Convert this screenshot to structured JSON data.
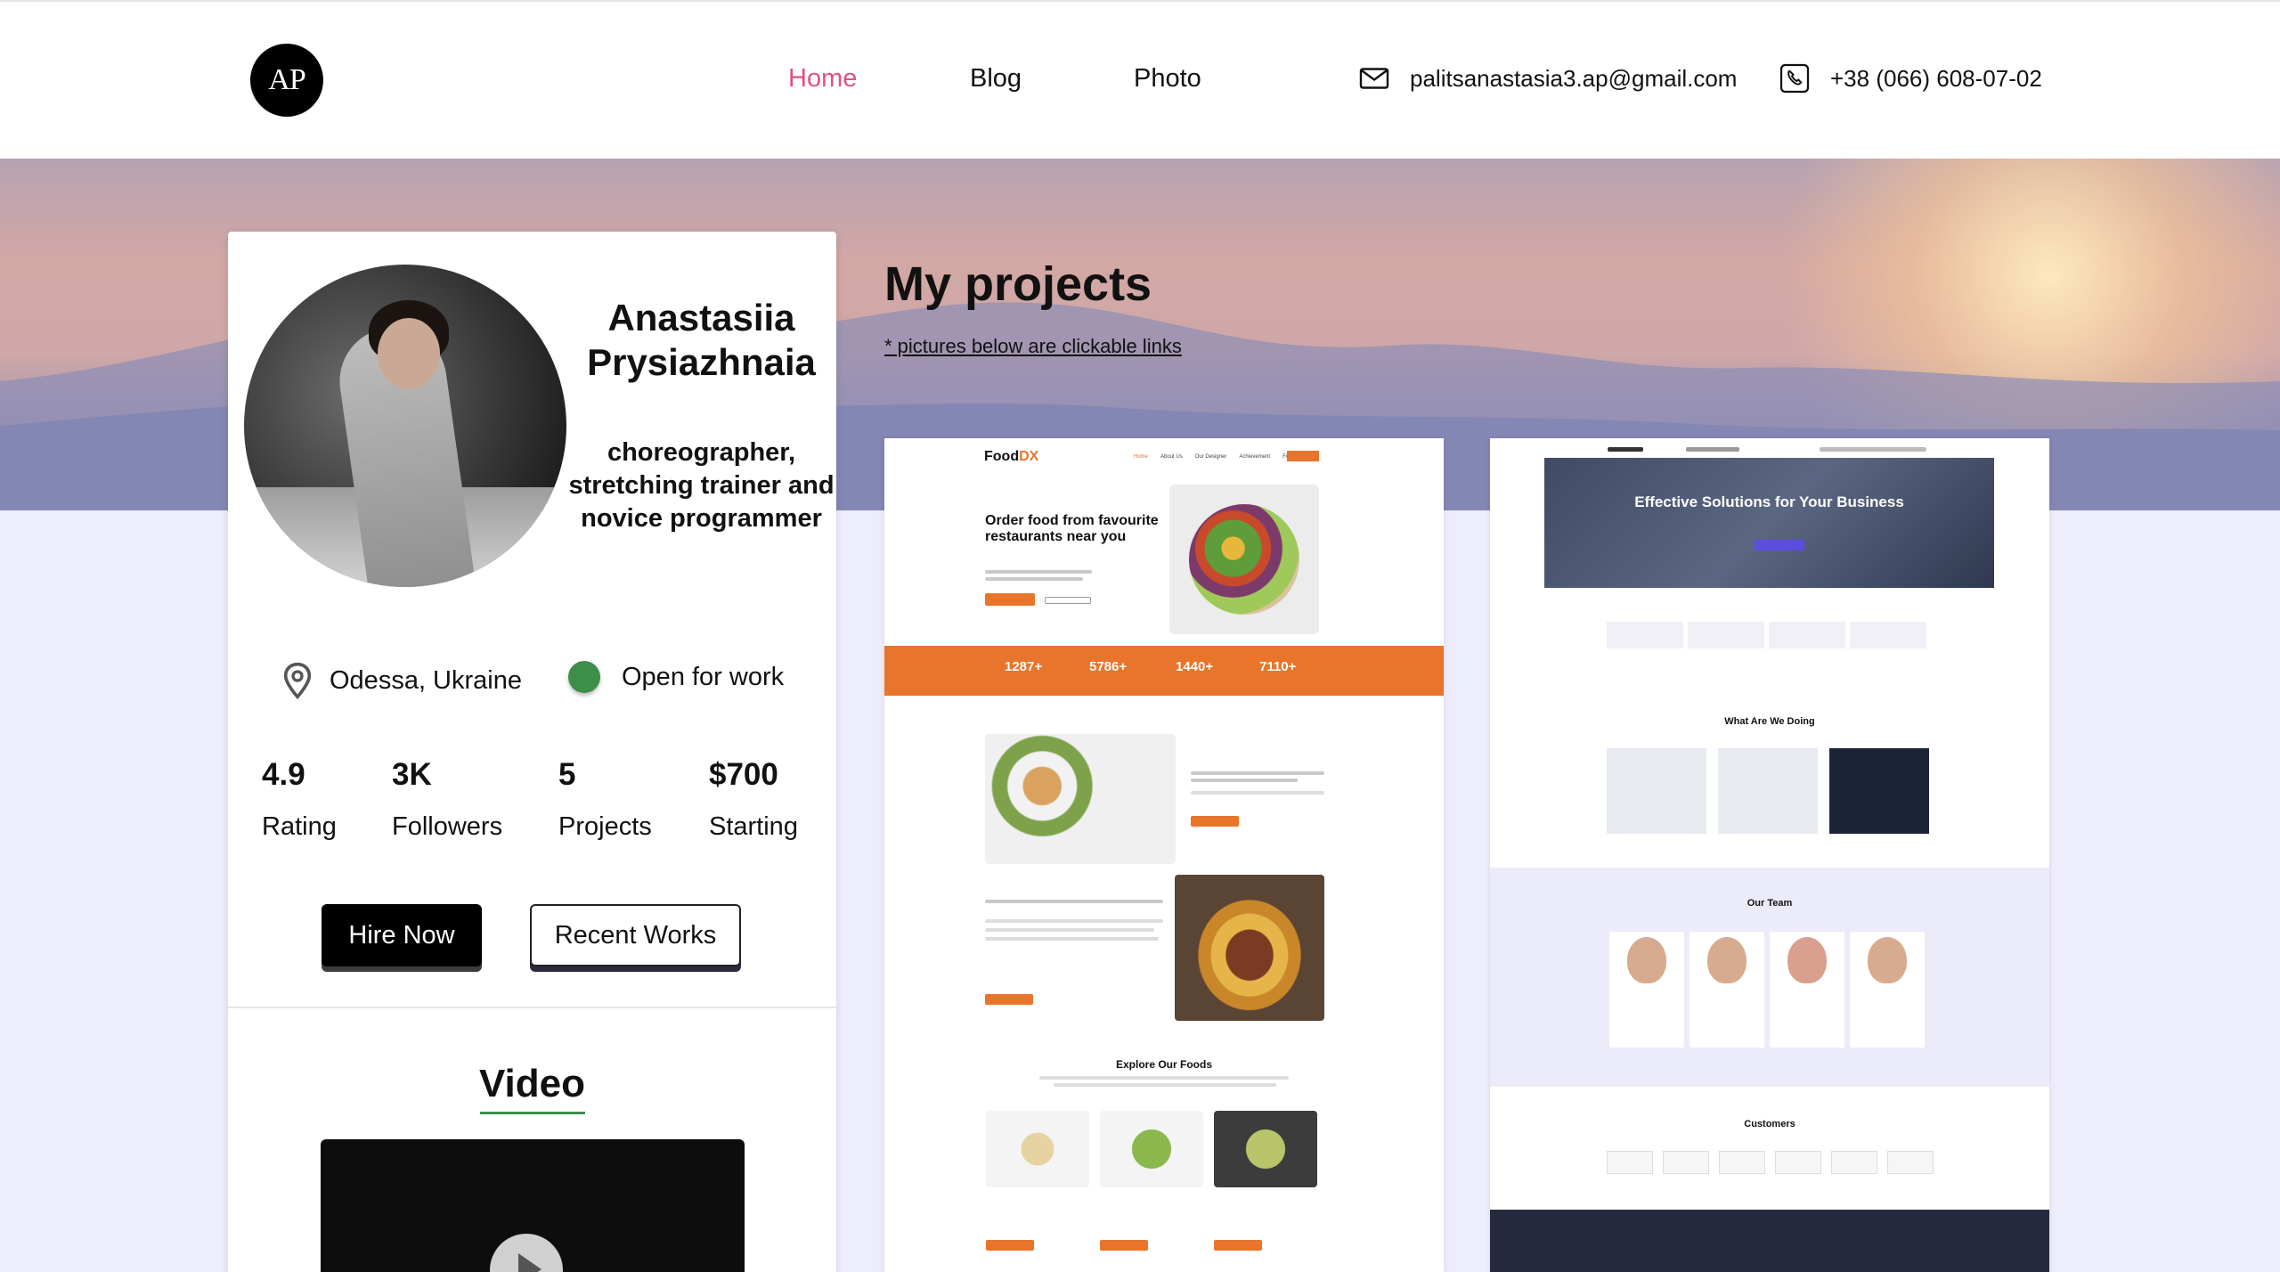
{
  "header": {
    "logo": "AP",
    "nav": [
      {
        "label": "Home",
        "active": true
      },
      {
        "label": "Blog",
        "active": false
      },
      {
        "label": "Photo",
        "active": false
      }
    ],
    "email": "palitsanastasia3.ap@gmail.com",
    "phone": "+38 (066) 608-07-02",
    "email_icon": "mail-icon",
    "phone_icon": "phone-icon"
  },
  "profile": {
    "name": "Anastasiia Prysiazhnaia",
    "role": "choreographer, stretching trainer and novice programmer",
    "location": "Odessa, Ukraine",
    "status": "Open for work",
    "status_color": "#3e8e4b",
    "stats": [
      {
        "value": "4.9",
        "label": "Rating"
      },
      {
        "value": "3K",
        "label": "Followers"
      },
      {
        "value": "5",
        "label": "Projects"
      },
      {
        "value": "$700",
        "label": "Starting"
      }
    ],
    "buttons": {
      "hire": "Hire Now",
      "recent": "Recent Works"
    },
    "video_title": "Video"
  },
  "projects": {
    "title": "My projects",
    "note": "* pictures below are clickable links",
    "food": {
      "logo_a": "Food",
      "logo_b": "DX",
      "nav": [
        "Home",
        "About Us",
        "Our Designer",
        "Achievement",
        "FAQ"
      ],
      "headline": "Order food from favourite restaurants near you",
      "stats": [
        "1287+",
        "5786+",
        "1440+",
        "7110+"
      ],
      "section": "Explore Our Foods",
      "accent": "#e8752b"
    },
    "studio": {
      "banner": "Effective Solutions for Your Business",
      "doing": "What Are We Doing",
      "team": "Our Team",
      "customers": "Customers",
      "accent": "#5b4de0"
    }
  }
}
